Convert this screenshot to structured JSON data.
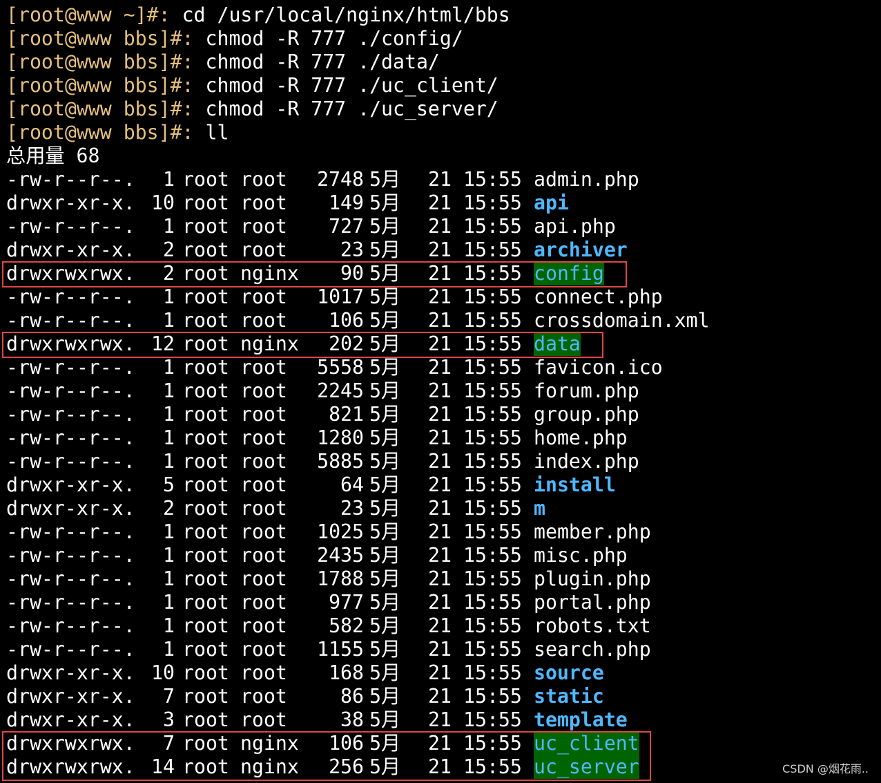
{
  "terminal": {
    "commands": [
      {
        "prompt": "[root@www ~]#:",
        "command": " cd /usr/local/nginx/html/bbs"
      },
      {
        "prompt": "[root@www bbs]#:",
        "command": " chmod -R 777 ./config/"
      },
      {
        "prompt": "[root@www bbs]#:",
        "command": " chmod -R 777 ./data/"
      },
      {
        "prompt": "[root@www bbs]#:",
        "command": " chmod -R 777 ./uc_client/"
      },
      {
        "prompt": "[root@www bbs]#:",
        "command": " chmod -R 777 ./uc_server/"
      },
      {
        "prompt": "[root@www bbs]#:",
        "command": " ll"
      }
    ],
    "total_line": "总用量 68",
    "listing": [
      {
        "perm": "-rw-r--r--.",
        "links": "1",
        "owner": "root",
        "group": "root",
        "size": "2748",
        "month": "5月",
        "day": "21",
        "time": "15:55",
        "name": "admin.php",
        "kind": "file"
      },
      {
        "perm": "drwxr-xr-x.",
        "links": "10",
        "owner": "root",
        "group": "root",
        "size": "149",
        "month": "5月",
        "day": "21",
        "time": "15:55",
        "name": "api",
        "kind": "dir"
      },
      {
        "perm": "-rw-r--r--.",
        "links": "1",
        "owner": "root",
        "group": "root",
        "size": "727",
        "month": "5月",
        "day": "21",
        "time": "15:55",
        "name": "api.php",
        "kind": "file"
      },
      {
        "perm": "drwxr-xr-x.",
        "links": "2",
        "owner": "root",
        "group": "root",
        "size": "23",
        "month": "5月",
        "day": "21",
        "time": "15:55",
        "name": "archiver",
        "kind": "dir"
      },
      {
        "perm": "drwxrwxrwx.",
        "links": "2",
        "owner": "root",
        "group": "nginx",
        "size": "90",
        "month": "5月",
        "day": "21",
        "time": "15:55",
        "name": "config",
        "kind": "dir-w"
      },
      {
        "perm": "-rw-r--r--.",
        "links": "1",
        "owner": "root",
        "group": "root",
        "size": "1017",
        "month": "5月",
        "day": "21",
        "time": "15:55",
        "name": "connect.php",
        "kind": "file"
      },
      {
        "perm": "-rw-r--r--.",
        "links": "1",
        "owner": "root",
        "group": "root",
        "size": "106",
        "month": "5月",
        "day": "21",
        "time": "15:55",
        "name": "crossdomain.xml",
        "kind": "file"
      },
      {
        "perm": "drwxrwxrwx.",
        "links": "12",
        "owner": "root",
        "group": "nginx",
        "size": "202",
        "month": "5月",
        "day": "21",
        "time": "15:55",
        "name": "data",
        "kind": "dir-w"
      },
      {
        "perm": "-rw-r--r--.",
        "links": "1",
        "owner": "root",
        "group": "root",
        "size": "5558",
        "month": "5月",
        "day": "21",
        "time": "15:55",
        "name": "favicon.ico",
        "kind": "file"
      },
      {
        "perm": "-rw-r--r--.",
        "links": "1",
        "owner": "root",
        "group": "root",
        "size": "2245",
        "month": "5月",
        "day": "21",
        "time": "15:55",
        "name": "forum.php",
        "kind": "file"
      },
      {
        "perm": "-rw-r--r--.",
        "links": "1",
        "owner": "root",
        "group": "root",
        "size": "821",
        "month": "5月",
        "day": "21",
        "time": "15:55",
        "name": "group.php",
        "kind": "file"
      },
      {
        "perm": "-rw-r--r--.",
        "links": "1",
        "owner": "root",
        "group": "root",
        "size": "1280",
        "month": "5月",
        "day": "21",
        "time": "15:55",
        "name": "home.php",
        "kind": "file"
      },
      {
        "perm": "-rw-r--r--.",
        "links": "1",
        "owner": "root",
        "group": "root",
        "size": "5885",
        "month": "5月",
        "day": "21",
        "time": "15:55",
        "name": "index.php",
        "kind": "file"
      },
      {
        "perm": "drwxr-xr-x.",
        "links": "5",
        "owner": "root",
        "group": "root",
        "size": "64",
        "month": "5月",
        "day": "21",
        "time": "15:55",
        "name": "install",
        "kind": "dir"
      },
      {
        "perm": "drwxr-xr-x.",
        "links": "2",
        "owner": "root",
        "group": "root",
        "size": "23",
        "month": "5月",
        "day": "21",
        "time": "15:55",
        "name": "m",
        "kind": "dir"
      },
      {
        "perm": "-rw-r--r--.",
        "links": "1",
        "owner": "root",
        "group": "root",
        "size": "1025",
        "month": "5月",
        "day": "21",
        "time": "15:55",
        "name": "member.php",
        "kind": "file"
      },
      {
        "perm": "-rw-r--r--.",
        "links": "1",
        "owner": "root",
        "group": "root",
        "size": "2435",
        "month": "5月",
        "day": "21",
        "time": "15:55",
        "name": "misc.php",
        "kind": "file"
      },
      {
        "perm": "-rw-r--r--.",
        "links": "1",
        "owner": "root",
        "group": "root",
        "size": "1788",
        "month": "5月",
        "day": "21",
        "time": "15:55",
        "name": "plugin.php",
        "kind": "file"
      },
      {
        "perm": "-rw-r--r--.",
        "links": "1",
        "owner": "root",
        "group": "root",
        "size": "977",
        "month": "5月",
        "day": "21",
        "time": "15:55",
        "name": "portal.php",
        "kind": "file"
      },
      {
        "perm": "-rw-r--r--.",
        "links": "1",
        "owner": "root",
        "group": "root",
        "size": "582",
        "month": "5月",
        "day": "21",
        "time": "15:55",
        "name": "robots.txt",
        "kind": "file"
      },
      {
        "perm": "-rw-r--r--.",
        "links": "1",
        "owner": "root",
        "group": "root",
        "size": "1155",
        "month": "5月",
        "day": "21",
        "time": "15:55",
        "name": "search.php",
        "kind": "file"
      },
      {
        "perm": "drwxr-xr-x.",
        "links": "10",
        "owner": "root",
        "group": "root",
        "size": "168",
        "month": "5月",
        "day": "21",
        "time": "15:55",
        "name": "source",
        "kind": "dir"
      },
      {
        "perm": "drwxr-xr-x.",
        "links": "7",
        "owner": "root",
        "group": "root",
        "size": "86",
        "month": "5月",
        "day": "21",
        "time": "15:55",
        "name": "static",
        "kind": "dir"
      },
      {
        "perm": "drwxr-xr-x.",
        "links": "3",
        "owner": "root",
        "group": "root",
        "size": "38",
        "month": "5月",
        "day": "21",
        "time": "15:55",
        "name": "template",
        "kind": "dir"
      },
      {
        "perm": "drwxrwxrwx.",
        "links": "7",
        "owner": "root",
        "group": "nginx",
        "size": "106",
        "month": "5月",
        "day": "21",
        "time": "15:55",
        "name": "uc_client",
        "kind": "dir-w"
      },
      {
        "perm": "drwxrwxrwx.",
        "links": "14",
        "owner": "root",
        "group": "nginx",
        "size": "256",
        "month": "5月",
        "day": "21",
        "time": "15:55",
        "name": "uc_server",
        "kind": "dir-w"
      }
    ]
  },
  "colors": {
    "background": "#000000",
    "prompt": "#e5c07b",
    "text": "#ffffff",
    "directory": "#4fb8ff",
    "world_writable_bg": "#006400",
    "highlight_box": "#e04545"
  },
  "watermark": "CSDN @烟花雨.."
}
